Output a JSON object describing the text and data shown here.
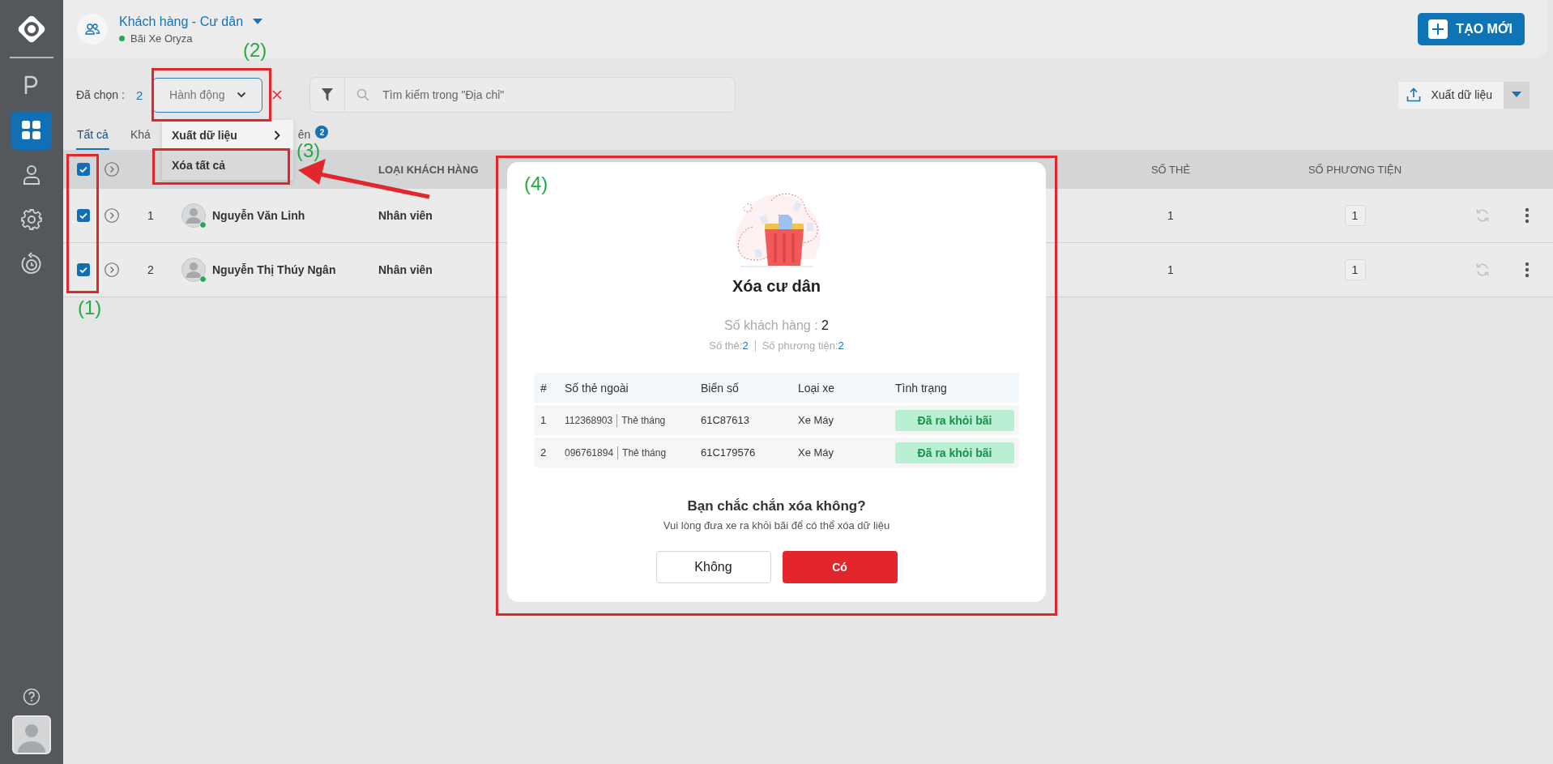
{
  "sidebar": {
    "items": [
      {
        "kind": "parking",
        "selected": false
      },
      {
        "kind": "dashboard",
        "selected": true
      },
      {
        "kind": "user",
        "selected": false
      },
      {
        "kind": "settings",
        "selected": false
      },
      {
        "kind": "history",
        "selected": false
      }
    ]
  },
  "header": {
    "title": "Khách hàng - Cư dân",
    "subtitle": "Bãi Xe Oryza",
    "create_button": "TẠO MỚI"
  },
  "toolbar": {
    "selected_label": "Đã chọn :",
    "selected_count": "2",
    "action_dropdown": "Hành động",
    "search_placeholder": "Tìm kiếm trong \"Địa chỉ\"",
    "export_button": "Xuất dữ liệu"
  },
  "action_menu": {
    "items": [
      {
        "label": "Xuất dữ liệu",
        "kind": "submenu",
        "selected": false
      },
      {
        "label": "Xóa tất cả",
        "kind": "action",
        "selected": true
      }
    ]
  },
  "tabs": [
    {
      "label": "Tất cả",
      "selected": true
    },
    {
      "label": "Khá",
      "selected": false
    },
    {
      "label": "ên",
      "selected": false,
      "badge": "2"
    }
  ],
  "table": {
    "all_checked": true,
    "columns": [
      "LOẠI KHÁCH HÀNG",
      "SỐ THẺ",
      "SỐ PHƯƠNG TIỆN"
    ],
    "rows": [
      {
        "checked": true,
        "index": "1",
        "name": "Nguyễn Văn Linh",
        "customer_type": "Nhân viên",
        "card_count": "1",
        "vehicle_count": "1"
      },
      {
        "checked": true,
        "index": "2",
        "name": "Nguyễn Thị Thúy Ngân",
        "customer_type": "Nhân viên",
        "card_count": "1",
        "vehicle_count": "1"
      }
    ]
  },
  "dialog": {
    "title": "Xóa cư dân",
    "customer_count_label": "Số khách hàng :",
    "customer_count": "2",
    "card_count_label": "Số thẻ:",
    "card_count": "2",
    "vehicle_count_label": "Số phương tiện:",
    "vehicle_count": "2",
    "columns": [
      "#",
      "Số thẻ ngoài",
      "Biển số",
      "Loại xe",
      "Tình trạng"
    ],
    "rows": [
      {
        "index": "1",
        "card_number": "112368903",
        "card_type": "Thẻ tháng",
        "plate": "61C87613",
        "vehicle_type": "Xe Máy",
        "status": "Đã ra khỏi bãi"
      },
      {
        "index": "2",
        "card_number": "096761894",
        "card_type": "Thẻ tháng",
        "plate": "61C179576",
        "vehicle_type": "Xe Máy",
        "status": "Đã ra khỏi bãi"
      }
    ],
    "question": "Bạn chắc chắn xóa không?",
    "note": "Vui lòng đưa xe ra khỏi bãi để có thể xóa dữ liệu",
    "cancel_button": "Không",
    "confirm_button": "Có"
  },
  "annotations": [
    {
      "label": "(1)"
    },
    {
      "label": "(2)"
    },
    {
      "label": "(3)"
    },
    {
      "label": "(4)"
    }
  ]
}
